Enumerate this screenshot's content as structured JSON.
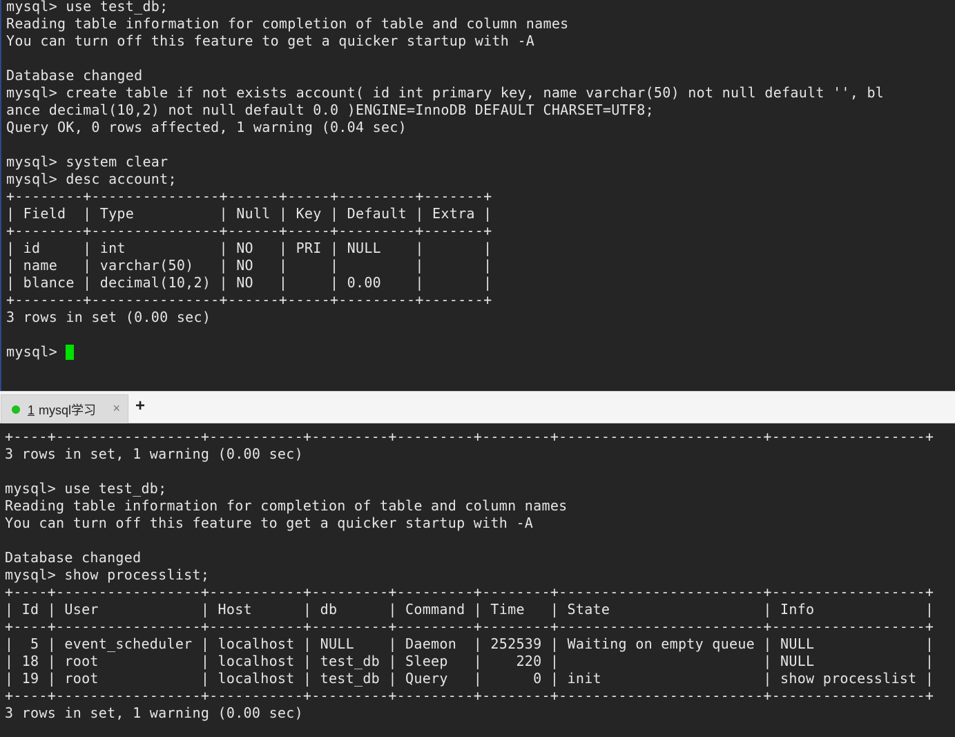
{
  "colors": {
    "terminal_bg": "#252526",
    "terminal_text": "#e6e6e6",
    "cursor": "#00e000",
    "status_dot": "#1fbf1f"
  },
  "top_terminal": {
    "lines": [
      "mysql> use test_db;",
      "Reading table information for completion of table and column names",
      "You can turn off this feature to get a quicker startup with -A",
      "",
      "Database changed",
      "mysql> create table if not exists account( id int primary key, name varchar(50) not null default '', bl",
      "ance decimal(10,2) not null default 0.0 )ENGINE=InnoDB DEFAULT CHARSET=UTF8;",
      "Query OK, 0 rows affected, 1 warning (0.04 sec)",
      "",
      "mysql> system clear",
      "mysql> desc account;",
      "+--------+---------------+------+-----+---------+-------+",
      "| Field  | Type          | Null | Key | Default | Extra |",
      "+--------+---------------+------+-----+---------+-------+",
      "| id     | int           | NO   | PRI | NULL    |       |",
      "| name   | varchar(50)   | NO   |     |         |       |",
      "| blance | decimal(10,2) | NO   |     | 0.00    |       |",
      "+--------+---------------+------+-----+---------+-------+",
      "3 rows in set (0.00 sec)",
      ""
    ],
    "prompt": "mysql>"
  },
  "tab_bar": {
    "tab": {
      "number": "1",
      "label": "mysql学习",
      "close_glyph": "×"
    },
    "add_glyph": "+"
  },
  "bottom_terminal": {
    "lines": [
      "+----+-----------------+-----------+---------+---------+--------+------------------------+------------------+",
      "3 rows in set, 1 warning (0.00 sec)",
      "",
      "mysql> use test_db;",
      "Reading table information for completion of table and column names",
      "You can turn off this feature to get a quicker startup with -A",
      "",
      "Database changed",
      "mysql> show processlist;",
      "+----+-----------------+-----------+---------+---------+--------+------------------------+------------------+",
      "| Id | User            | Host      | db      | Command | Time   | State                  | Info             |",
      "+----+-----------------+-----------+---------+---------+--------+------------------------+------------------+",
      "|  5 | event_scheduler | localhost | NULL    | Daemon  | 252539 | Waiting on empty queue | NULL             |",
      "| 18 | root            | localhost | test_db | Sleep   |    220 |                        | NULL             |",
      "| 19 | root            | localhost | test_db | Query   |      0 | init                   | show processlist |",
      "+----+-----------------+-----------+---------+---------+--------+------------------------+------------------+",
      "3 rows in set, 1 warning (0.00 sec)"
    ]
  }
}
